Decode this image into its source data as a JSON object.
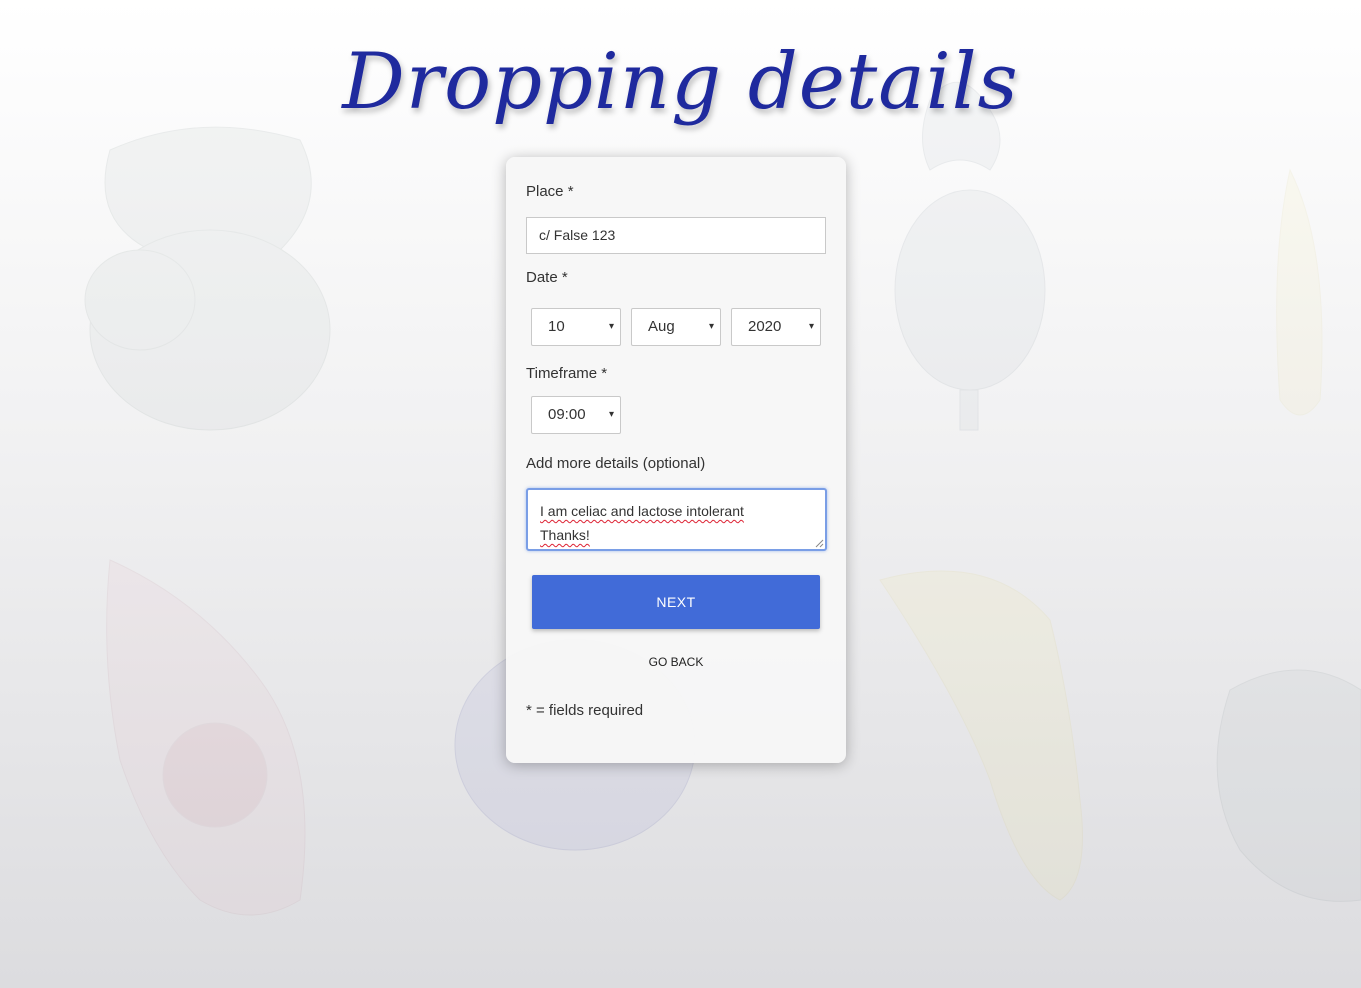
{
  "page": {
    "title": "Dropping details"
  },
  "form": {
    "place": {
      "label": "Place *",
      "value": "c/ False 123"
    },
    "date": {
      "label": "Date *",
      "day": "10",
      "month": "Aug",
      "year": "2020"
    },
    "timeframe": {
      "label": "Timeframe *",
      "value": "09:00"
    },
    "details": {
      "label": "Add more details (optional)",
      "line1": "I am celiac and lactose intolerant",
      "line2": "Thanks!"
    },
    "next_label": "NEXT",
    "back_label": "GO BACK",
    "footnote": "* = fields required"
  },
  "colors": {
    "title": "#1f2a9e",
    "button": "#416bd8"
  },
  "icons": {
    "select_caret": "▾"
  }
}
